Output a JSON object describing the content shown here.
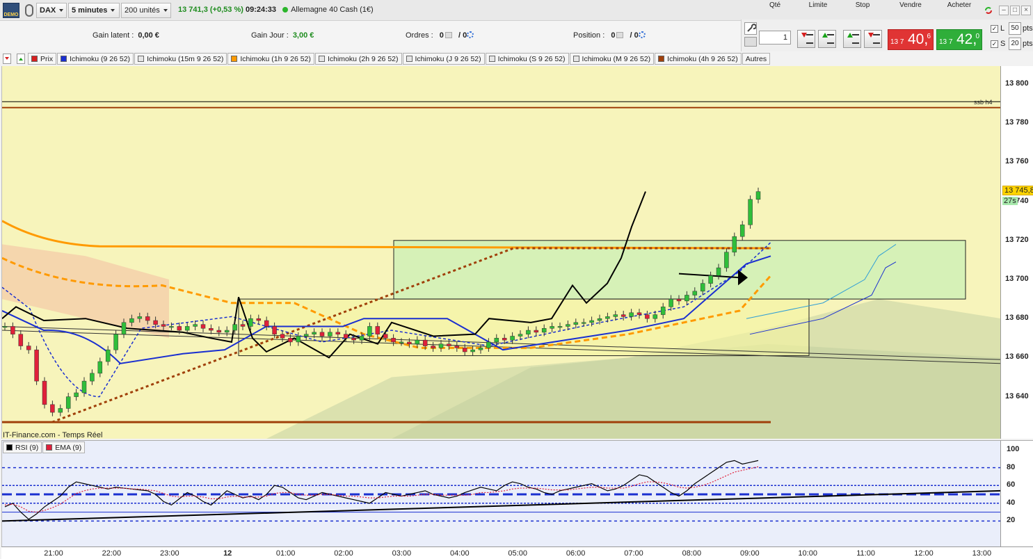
{
  "toolbar": {
    "demo_label": "DEMO",
    "instrument": "DAX",
    "timeframe": "5 minutes",
    "units": "200 unités",
    "last_price": "13 741,3",
    "change": "(+0,53 %)",
    "time": "09:24:33",
    "market_name": "Allemagne 40 Cash (1€)"
  },
  "info": {
    "gain_latent_label": "Gain latent :",
    "gain_latent_value": "0,00 €",
    "gain_jour_label": "Gain Jour :",
    "gain_jour_value": "3,00 €",
    "ordres_label": "Ordres :",
    "ordres_value_a": "0",
    "ordres_value_b": "/ 0",
    "position_label": "Position :",
    "position_value_a": "0",
    "position_value_b": "/ 0"
  },
  "trade": {
    "qte_label": "Qté",
    "qte_value": "1",
    "limite_label": "Limite",
    "stop_label": "Stop",
    "vendre_label": "Vendre",
    "acheter_label": "Acheter",
    "sell_small": "13 7",
    "sell_big": "40,",
    "sell_sup": "6",
    "buy_small": "13 7",
    "buy_big": "42,",
    "buy_sup": "0",
    "l_label": "L",
    "l_value": "50",
    "s_label": "S",
    "s_value": "20",
    "pts": "pts"
  },
  "legend": [
    {
      "label": "Prix",
      "color": "#d62020"
    },
    {
      "label": "Ichimoku (9 26 52)",
      "color": "#1a2fd0"
    },
    {
      "label": "Ichimoku (15m 9 26 52)",
      "color": "#e6e6e6"
    },
    {
      "label": "Ichimoku (1h 9 26 52)",
      "color": "#ff9a00"
    },
    {
      "label": "Ichimoku (2h 9 26 52)",
      "color": "#e6e6e6"
    },
    {
      "label": "Ichimoku (J 9 26 52)",
      "color": "#e6e6e6"
    },
    {
      "label": "Ichimoku (S 9 26 52)",
      "color": "#e6e6e6"
    },
    {
      "label": "Ichimoku (M 9 26 52)",
      "color": "#e6e6e6"
    },
    {
      "label": "Ichimoku (4h 9 26 52)",
      "color": "#a0400a"
    },
    {
      "label": "Autres",
      "color": ""
    }
  ],
  "source_label": "IT-Finance.com - Temps Réel",
  "rsi_legend": [
    {
      "label": "RSI (9)",
      "color": "#000000"
    },
    {
      "label": "EMA (9)",
      "color": "#e0203a"
    }
  ],
  "current_price_tag": "13 745,8",
  "countdown_tag": "27s",
  "ssb_label": "ssb h4",
  "chart_data": [
    {
      "type": "candlestick",
      "title": "DAX 5 minutes",
      "y_ticks": [
        "13 800",
        "13 780",
        "13 760",
        "13 740",
        "13 720",
        "13 700",
        "13 680",
        "13 660",
        "13 640"
      ],
      "y_tick_values": [
        13800,
        13780,
        13760,
        13740,
        13720,
        13700,
        13680,
        13660,
        13640
      ],
      "ylim": [
        13622,
        13810
      ],
      "x_ticks": [
        "21:00",
        "22:00",
        "23:00",
        "12",
        "01:00",
        "02:00",
        "03:00",
        "04:00",
        "05:00",
        "06:00",
        "07:00",
        "08:00",
        "09:00",
        "10:00",
        "11:00",
        "12:00",
        "13:00"
      ],
      "last_price": 13745.8,
      "horizontal_levels": [
        {
          "name": "ssb h4",
          "value": 13788,
          "color": "#a0400a"
        },
        {
          "value": 13627,
          "color": "#a0400a"
        },
        {
          "value": 13716,
          "color": "#ff9a00"
        }
      ],
      "rectangles": [
        {
          "from": "02:45",
          "to": "12:40",
          "top": 13720,
          "bottom": 13690
        },
        {
          "from": "23:55",
          "to": "10:00",
          "top": 13690,
          "bottom": 13661
        }
      ],
      "close_series": [
        13676,
        13672,
        13666,
        13664,
        13648,
        13636,
        13632,
        13634,
        13640,
        13642,
        13648,
        13652,
        13658,
        13664,
        13672,
        13678,
        13680,
        13681,
        13679,
        13677,
        13676,
        13676,
        13674,
        13676,
        13677,
        13675,
        13674,
        13673,
        13674,
        13677,
        13676,
        13680,
        13679,
        13676,
        13672,
        13670,
        13668,
        13671,
        13672,
        13673,
        13671,
        13673,
        13672,
        13670,
        13669,
        13671,
        13676,
        13672,
        13670,
        13668,
        13668,
        13667,
        13669,
        13666,
        13665,
        13667,
        13666,
        13665,
        13663,
        13664,
        13665,
        13668,
        13670,
        13669,
        13671,
        13672,
        13674,
        13673,
        13675,
        13676,
        13676,
        13677,
        13678,
        13678,
        13679,
        13680,
        13681,
        13682,
        13681,
        13683,
        13682,
        13680,
        13682,
        13686,
        13690,
        13689,
        13692,
        13694,
        13698,
        13702,
        13706,
        13714,
        13722,
        13728,
        13741,
        13745
      ]
    },
    {
      "type": "line",
      "title": "RSI (9)",
      "y_ticks": [
        "100",
        "80",
        "60",
        "40",
        "20"
      ],
      "y_tick_values": [
        100,
        80,
        60,
        40,
        20
      ],
      "ylim": [
        0,
        100
      ],
      "levels": [
        80,
        60,
        50,
        40,
        20
      ],
      "series": [
        {
          "name": "RSI (9)",
          "values": [
            36,
            40,
            30,
            22,
            28,
            36,
            42,
            48,
            58,
            64,
            62,
            60,
            58,
            56,
            58,
            57,
            56,
            55,
            54,
            50,
            42,
            38,
            45,
            52,
            48,
            42,
            38,
            46,
            54,
            50,
            46,
            48,
            44,
            50,
            60,
            58,
            52,
            46,
            44,
            48,
            52,
            50,
            48,
            46,
            44,
            42,
            40,
            46,
            52,
            50,
            48,
            50,
            52,
            54,
            50,
            48,
            46,
            48,
            52,
            55,
            58,
            56,
            54,
            60,
            64,
            62,
            58,
            56,
            52,
            50,
            54,
            56,
            58,
            60,
            62,
            58,
            54,
            56,
            60,
            66,
            72,
            70,
            64,
            58,
            52,
            48,
            54,
            62,
            68,
            74,
            80,
            86,
            88,
            84,
            86,
            88
          ]
        },
        {
          "name": "EMA (9)",
          "values": [
            38,
            39,
            36,
            31,
            30,
            32,
            35,
            39,
            45,
            51,
            54,
            56,
            57,
            57,
            57,
            57,
            56,
            56,
            55,
            54,
            51,
            48,
            47,
            48,
            48,
            47,
            45,
            45,
            47,
            48,
            47,
            47,
            47,
            48,
            51,
            52,
            52,
            50,
            49,
            49,
            50,
            50,
            49,
            48,
            48,
            47,
            46,
            46,
            47,
            48,
            48,
            48,
            49,
            50,
            50,
            49,
            49,
            49,
            49,
            50,
            52,
            52,
            53,
            54,
            56,
            57,
            57,
            57,
            56,
            55,
            55,
            55,
            56,
            57,
            58,
            58,
            57,
            57,
            57,
            59,
            62,
            64,
            64,
            63,
            61,
            58,
            57,
            58,
            60,
            63,
            67,
            71,
            75,
            77,
            79,
            81
          ]
        }
      ]
    }
  ]
}
